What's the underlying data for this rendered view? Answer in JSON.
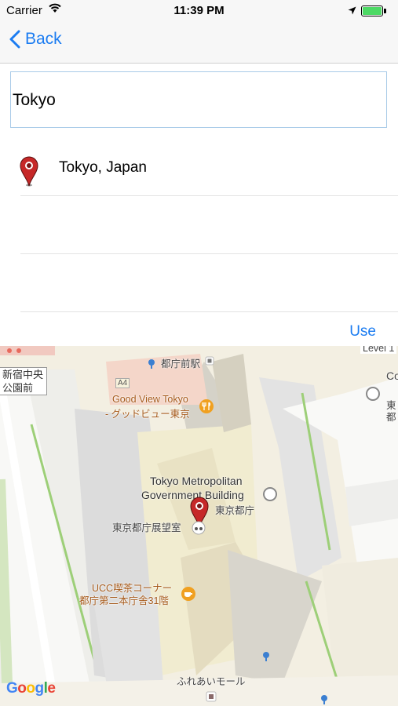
{
  "status_bar": {
    "carrier": "Carrier",
    "time": "11:39 PM"
  },
  "nav": {
    "back_label": "Back"
  },
  "search": {
    "value": "Tokyo"
  },
  "results": [
    {
      "label": "Tokyo, Japan",
      "icon": "map-pin-icon"
    },
    {
      "label": ""
    },
    {
      "label": ""
    }
  ],
  "use_label": "Use",
  "map": {
    "labels": {
      "level": "Level 1",
      "tochomae": "都庁前駅",
      "a4": "A4",
      "shinjuku_chuo_1": "新宿中央",
      "shinjuku_chuo_2": "公園前",
      "good_view_1": "Good View Tokyo",
      "good_view_2": "- グッドビュー東京",
      "tmg_1": "Tokyo Metropolitan",
      "tmg_2": "Government Building",
      "tmg_jp": "東京都庁",
      "observatory": "東京都庁展望室",
      "ucc_1": "UCC喫茶コーナー",
      "ucc_2": "都庁第二本庁舎31階",
      "fureai": "ふれあいモール",
      "right_co": "Co",
      "right_to": "東",
      "right_mi": "都"
    },
    "logo": "Google"
  }
}
